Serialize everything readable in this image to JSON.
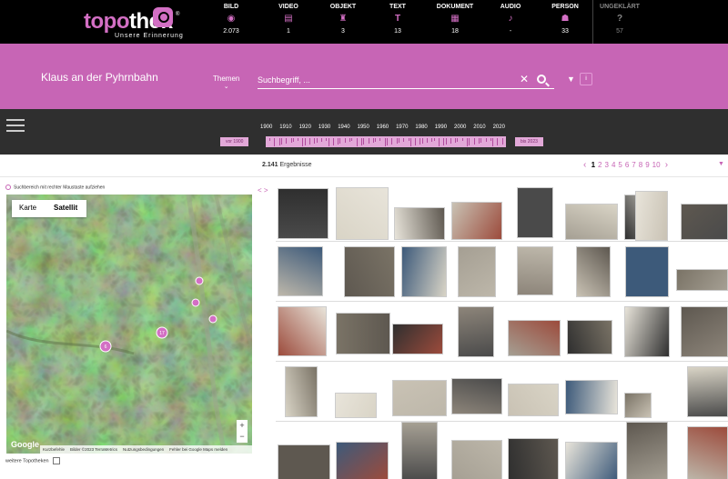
{
  "logo": {
    "first": "topo",
    "second": "thek",
    "tagline": "Unsere Erinnerung",
    "reg": "®"
  },
  "categories": [
    {
      "label": "BILD",
      "count": "2.073",
      "icon": "camera-icon",
      "glyph": "◉"
    },
    {
      "label": "VIDEO",
      "count": "1",
      "icon": "video-icon",
      "glyph": "▤"
    },
    {
      "label": "OBJEKT",
      "count": "3",
      "icon": "object-icon",
      "glyph": "♜"
    },
    {
      "label": "TEXT",
      "count": "13",
      "icon": "text-icon",
      "glyph": "T"
    },
    {
      "label": "DOKUMENT",
      "count": "18",
      "icon": "document-icon",
      "glyph": "▦"
    },
    {
      "label": "AUDIO",
      "count": "-",
      "icon": "audio-icon",
      "glyph": "♪"
    },
    {
      "label": "PERSON",
      "count": "33",
      "icon": "person-icon",
      "glyph": "☗"
    },
    {
      "label": "UNGEKLÄRT",
      "count": "57",
      "icon": "question-icon",
      "glyph": "?"
    }
  ],
  "header": {
    "place": "Klaus an der Pyhrnbahn",
    "themes": "Themen",
    "search_placeholder": "Suchbegriff, ...",
    "info": "i"
  },
  "timeline": {
    "years": [
      "1900",
      "1910",
      "1920",
      "1930",
      "1940",
      "1950",
      "1960",
      "1970",
      "1980",
      "1990",
      "2000",
      "2010",
      "2020"
    ],
    "from": "vor 1900",
    "to": "bis 2023"
  },
  "results": {
    "count": "2.141",
    "label": "Ergebnisse"
  },
  "pager": {
    "pages": [
      "1",
      "2",
      "3",
      "4",
      "5",
      "6",
      "7",
      "8",
      "9",
      "10"
    ],
    "current": "1"
  },
  "map": {
    "hint": "Suchbereich mit rechter Maustaste aufziehen",
    "tab_map": "Karte",
    "tab_satellite": "Satellit",
    "markers": [
      {
        "label": "6"
      },
      {
        "label": "17"
      },
      {
        "label": ""
      },
      {
        "label": ""
      },
      {
        "label": ""
      }
    ],
    "google": "Google",
    "attribution": [
      "Kurzbefehle",
      "Bilder ©2023 TerraMetrics",
      "Nutzungsbedingungen",
      "Fehler bei Google Maps melden"
    ],
    "more": "weitere Topotheken",
    "zoom_in": "+",
    "zoom_out": "−"
  },
  "colors": {
    "accent": "#c765b5",
    "band": "#c765b5",
    "topbar": "#000000",
    "timeline": "#2f2f2f"
  }
}
